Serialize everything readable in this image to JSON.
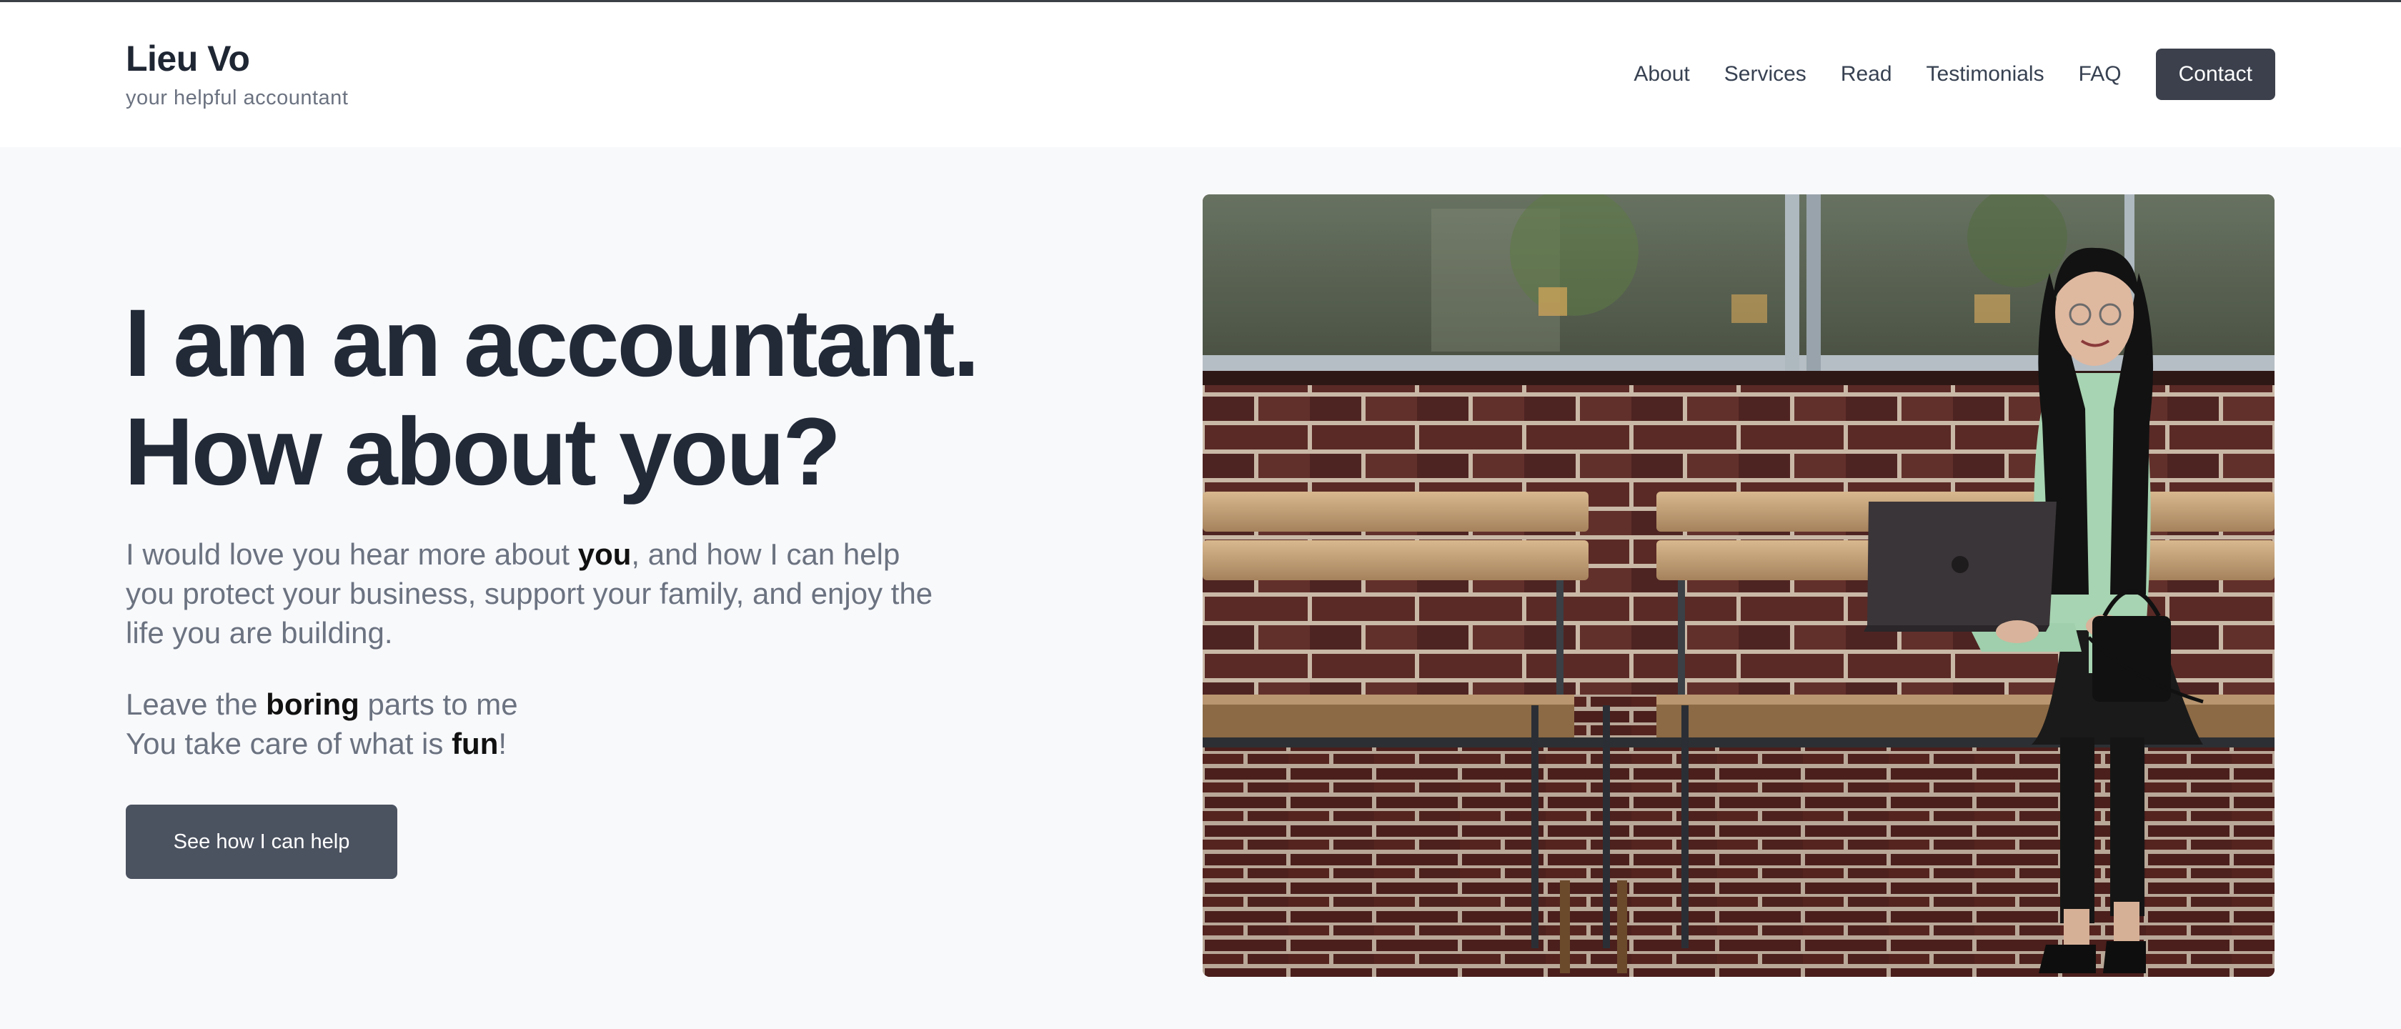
{
  "header": {
    "brand_name": "Lieu Vo",
    "tagline": "your helpful accountant",
    "nav": [
      {
        "label": "About"
      },
      {
        "label": "Services"
      },
      {
        "label": "Read"
      },
      {
        "label": "Testimonials"
      },
      {
        "label": "FAQ"
      }
    ],
    "contact_label": "Contact"
  },
  "hero": {
    "title_line1": "I am an accountant.",
    "title_line2": "How about you?",
    "p1_before": "I would love you hear more about ",
    "p1_bold": "you",
    "p1_after": ", and how I can help you protect your business, support your family, and enjoy the life you are building.",
    "p2_line1_before": "Leave the ",
    "p2_line1_bold": "boring",
    "p2_line1_after": " parts to me",
    "p2_line2_before": "You take care of what is ",
    "p2_line2_bold": "fun",
    "p2_line2_after": "!",
    "cta_label": "See how I can help"
  },
  "colors": {
    "page_bg": "#f8f9fb",
    "header_bg": "#ffffff",
    "heading": "#222a38",
    "body_text": "#6b7280",
    "contact_button": "#3b404c",
    "cta_button": "#4b5260"
  }
}
